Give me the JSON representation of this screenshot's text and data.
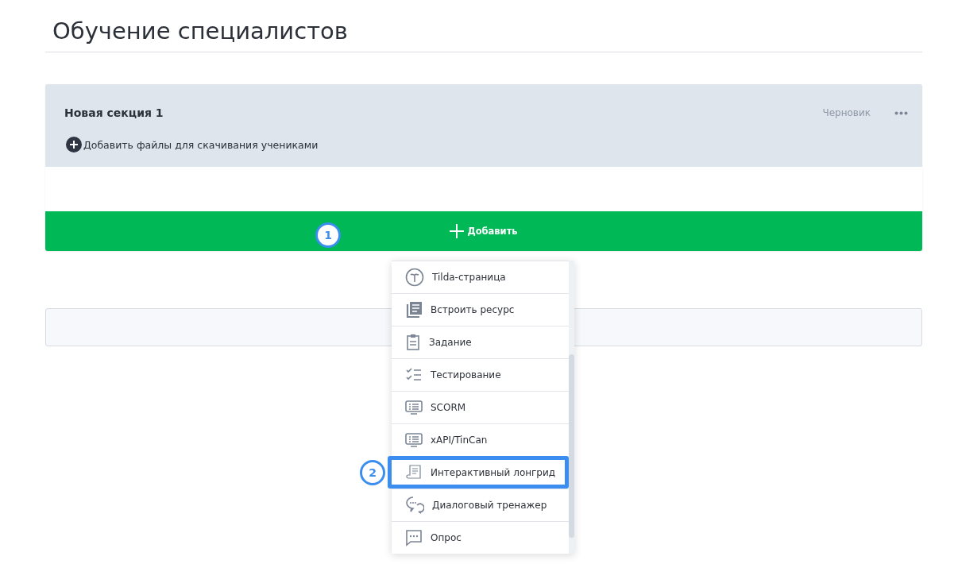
{
  "page": {
    "title": "Обучение специалистов"
  },
  "section": {
    "title": "Новая секция 1",
    "status": "Черновик",
    "add_files": "Добавить файлы для скачивания учениками",
    "add_button": "Добавить",
    "callout": "1"
  },
  "menu": {
    "items": [
      {
        "label": "Tilda-страница",
        "highlighted": false
      },
      {
        "label": "Встроить ресурс",
        "highlighted": false
      },
      {
        "label": "Задание",
        "highlighted": false
      },
      {
        "label": "Тестирование",
        "highlighted": false
      },
      {
        "label": "SCORM",
        "highlighted": false
      },
      {
        "label": "xAPI/TinCan",
        "highlighted": false
      },
      {
        "label": "Интерактивный лонгрид",
        "highlighted": true,
        "callout": "2"
      },
      {
        "label": "Диалоговый тренажер",
        "highlighted": false
      },
      {
        "label": "Опрос",
        "highlighted": false
      }
    ]
  }
}
